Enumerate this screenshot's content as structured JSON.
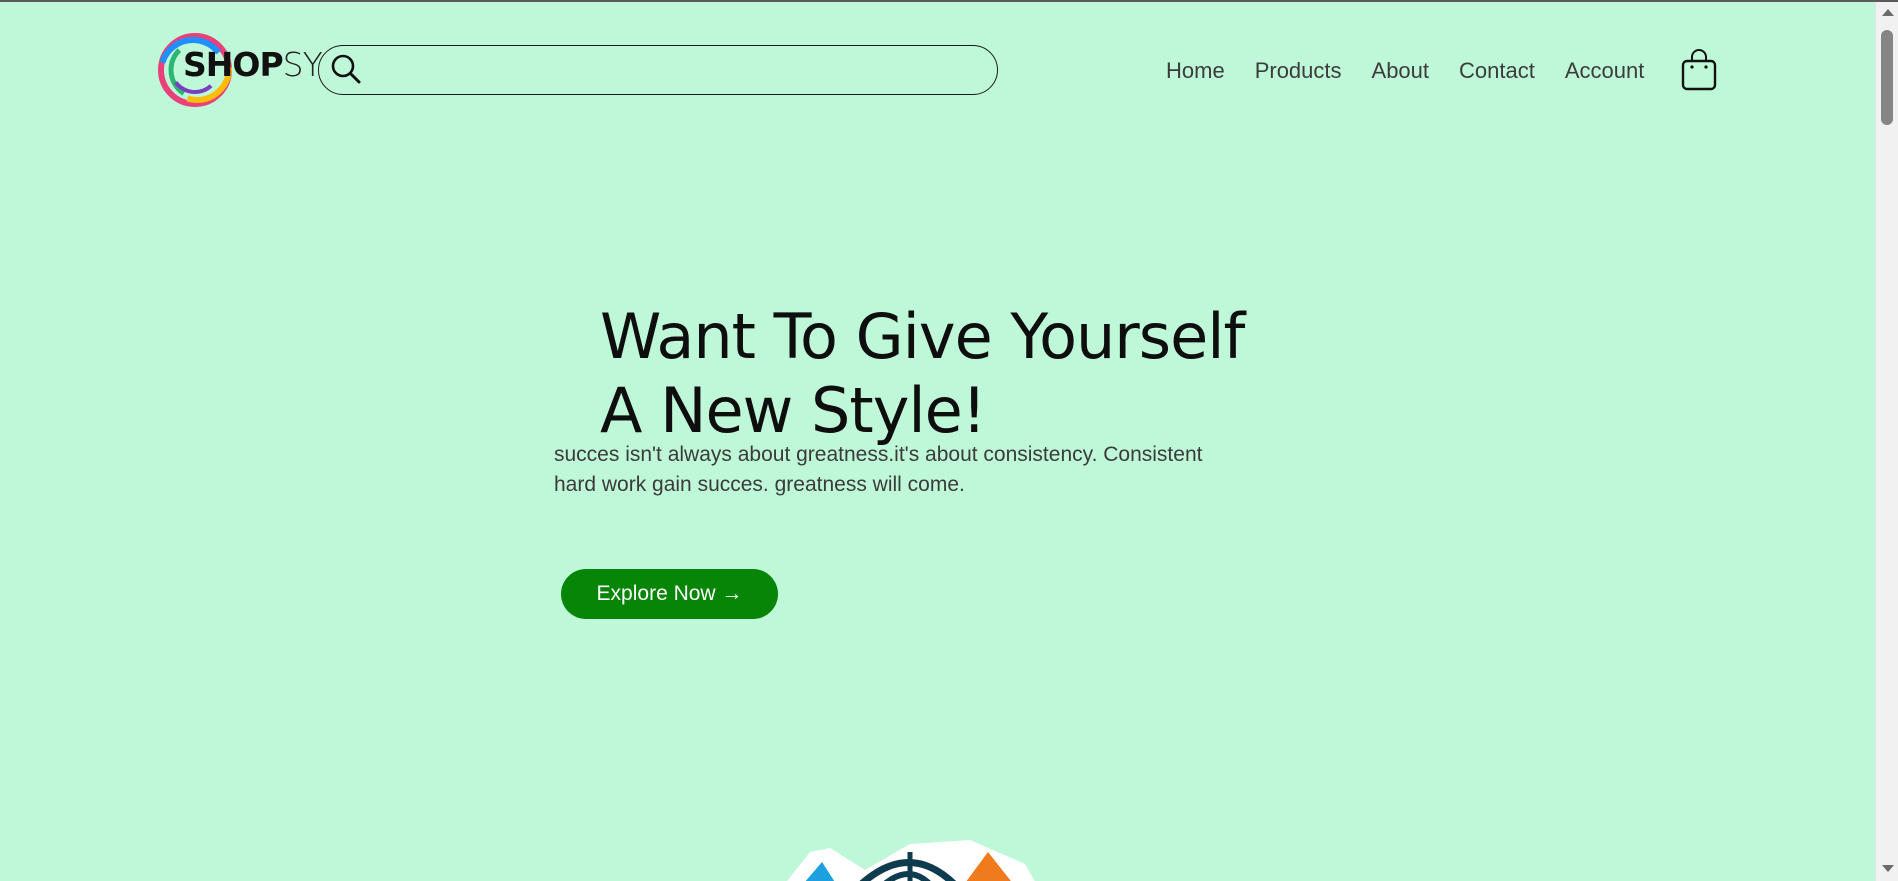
{
  "header": {
    "logo": {
      "text_bold": "SHOP",
      "text_light": "SY",
      "ring_colors": [
        "#e8407a",
        "#fbbd08",
        "#2bb673",
        "#1e90ff",
        "#7a3fc0"
      ]
    },
    "search": {
      "placeholder": "",
      "value": "",
      "icon": "search-icon"
    },
    "nav": [
      {
        "label": "Home"
      },
      {
        "label": "Products"
      },
      {
        "label": "About"
      },
      {
        "label": "Contact"
      },
      {
        "label": "Account"
      }
    ],
    "cart_icon": "shopping-bag-icon"
  },
  "hero": {
    "title_line1": "Want To Give Yourself",
    "title_line2": "A New Style!",
    "subtitle_line1": "succes isn't always about greatness.it's about consistency. Consistent",
    "subtitle_line2": "hard work gain succes. greatness will come.",
    "cta_label": "Explore Now →"
  },
  "colors": {
    "background": "#bff8d8",
    "cta_background": "#068507",
    "cta_text": "#ffffff",
    "text_dark": "#0e0e0e",
    "text_muted": "#3b3b3b"
  }
}
